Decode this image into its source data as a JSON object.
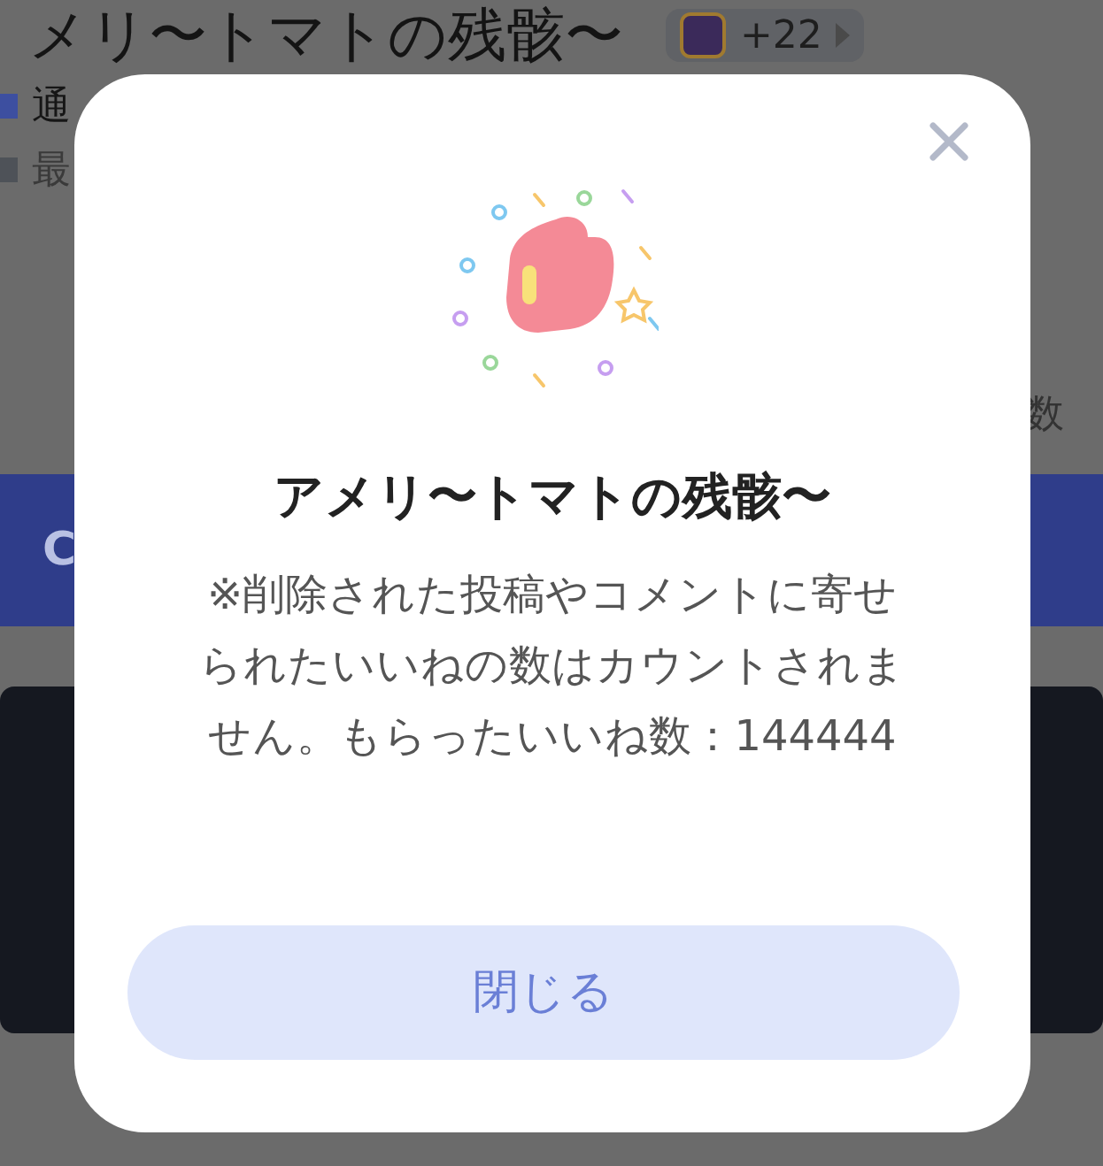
{
  "background": {
    "title": "メリ〜トマトの残骸〜",
    "badge_count": "+22",
    "rows": [
      "通",
      "最"
    ],
    "stat_label": "数",
    "banner_text": "C"
  },
  "dialog": {
    "title": "アメリ〜トマトの残骸〜",
    "message": "※削除された投稿やコメントに寄せられたいいねの数はカウントされません。もらったいいね数：144444",
    "close_button": "閉じる"
  }
}
